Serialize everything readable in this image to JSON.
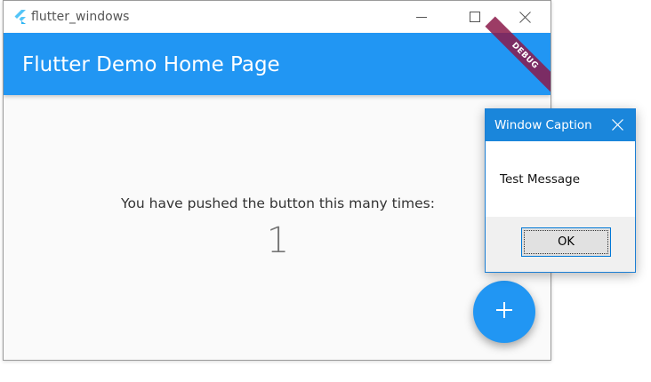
{
  "window": {
    "title": "flutter_windows",
    "minimize_icon": "minimize-icon",
    "maximize_icon": "maximize-icon",
    "close_icon": "close-icon"
  },
  "appbar": {
    "title": "Flutter Demo Home Page",
    "color": "#2196f3"
  },
  "debug_banner": {
    "label": "DEBUG",
    "color": "#8b1a4a"
  },
  "counter": {
    "label": "You have pushed the button this many times:",
    "value": "1"
  },
  "fab": {
    "icon": "plus-icon",
    "color": "#2196f3"
  },
  "dialog": {
    "title": "Window Caption",
    "message": "Test Message",
    "ok_label": "OK",
    "close_icon": "close-icon",
    "title_color": "#1a86db"
  }
}
